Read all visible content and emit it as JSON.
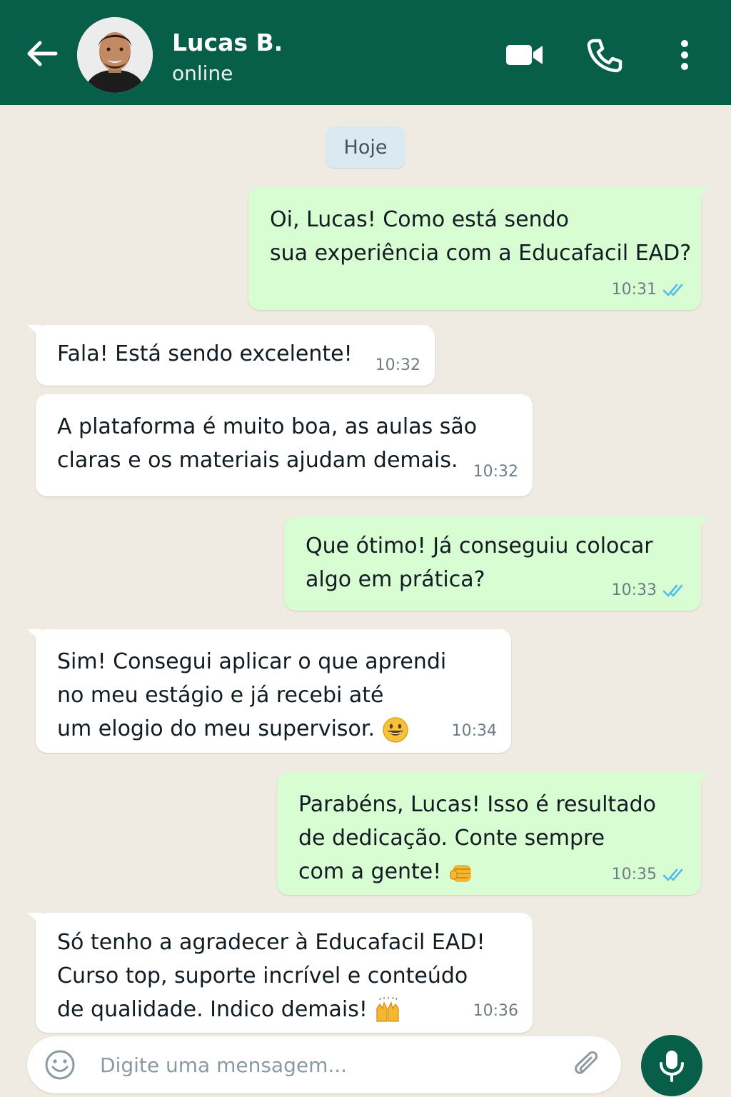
{
  "header": {
    "contact_name": "Lucas B.",
    "status": "online",
    "icons": [
      "back-arrow-icon",
      "video-call-icon",
      "phone-icon",
      "more-options-icon"
    ],
    "color": "#075e49"
  },
  "date_chip": "Hoje",
  "messages": [
    {
      "direction": "outgoing",
      "lines": [
        "Oi, Lucas! Como está sendo",
        "sua experiência com a Educafacil EAD?"
      ],
      "time": "10:31",
      "read": true
    },
    {
      "direction": "incoming",
      "lines": [
        "Fala! Está sendo excelente!"
      ],
      "time": "10:32"
    },
    {
      "direction": "incoming",
      "lines": [
        "A plataforma é muito boa, as aulas são",
        "claras e os materiais ajudam demais."
      ],
      "time": "10:32"
    },
    {
      "direction": "outgoing",
      "lines": [
        "Que ótimo! Já conseguiu colocar",
        "algo em prática?"
      ],
      "time": "10:33",
      "read": true
    },
    {
      "direction": "incoming",
      "lines": [
        "Sim! Consegui aplicar o que aprendi",
        "no meu estágio e já recebi até",
        "um elogio do meu supervisor."
      ],
      "emoji": "grinning-face",
      "time": "10:34"
    },
    {
      "direction": "outgoing",
      "lines": [
        "Parabéns, Lucas! Isso é resultado",
        "de dedicação. Conte sempre",
        "com a gente!"
      ],
      "emoji": "fist-bump",
      "time": "10:35",
      "read": true
    },
    {
      "direction": "incoming",
      "lines": [
        "Só tenho a agradecer à Educafacil EAD!",
        "Curso top, suporte incrível e conteúdo",
        "de qualidade. Indico demais!"
      ],
      "emoji": "raising-hands",
      "time": "10:36"
    }
  ],
  "input": {
    "placeholder": "Digite uma mensagem...",
    "icons": [
      "emoji-icon",
      "attach-icon",
      "microphone-icon"
    ]
  },
  "colors": {
    "outgoing_bubble": "#d9fdd3",
    "incoming_bubble": "#ffffff",
    "chat_background": "#efeae2",
    "read_ticks": "#53bdeb"
  }
}
